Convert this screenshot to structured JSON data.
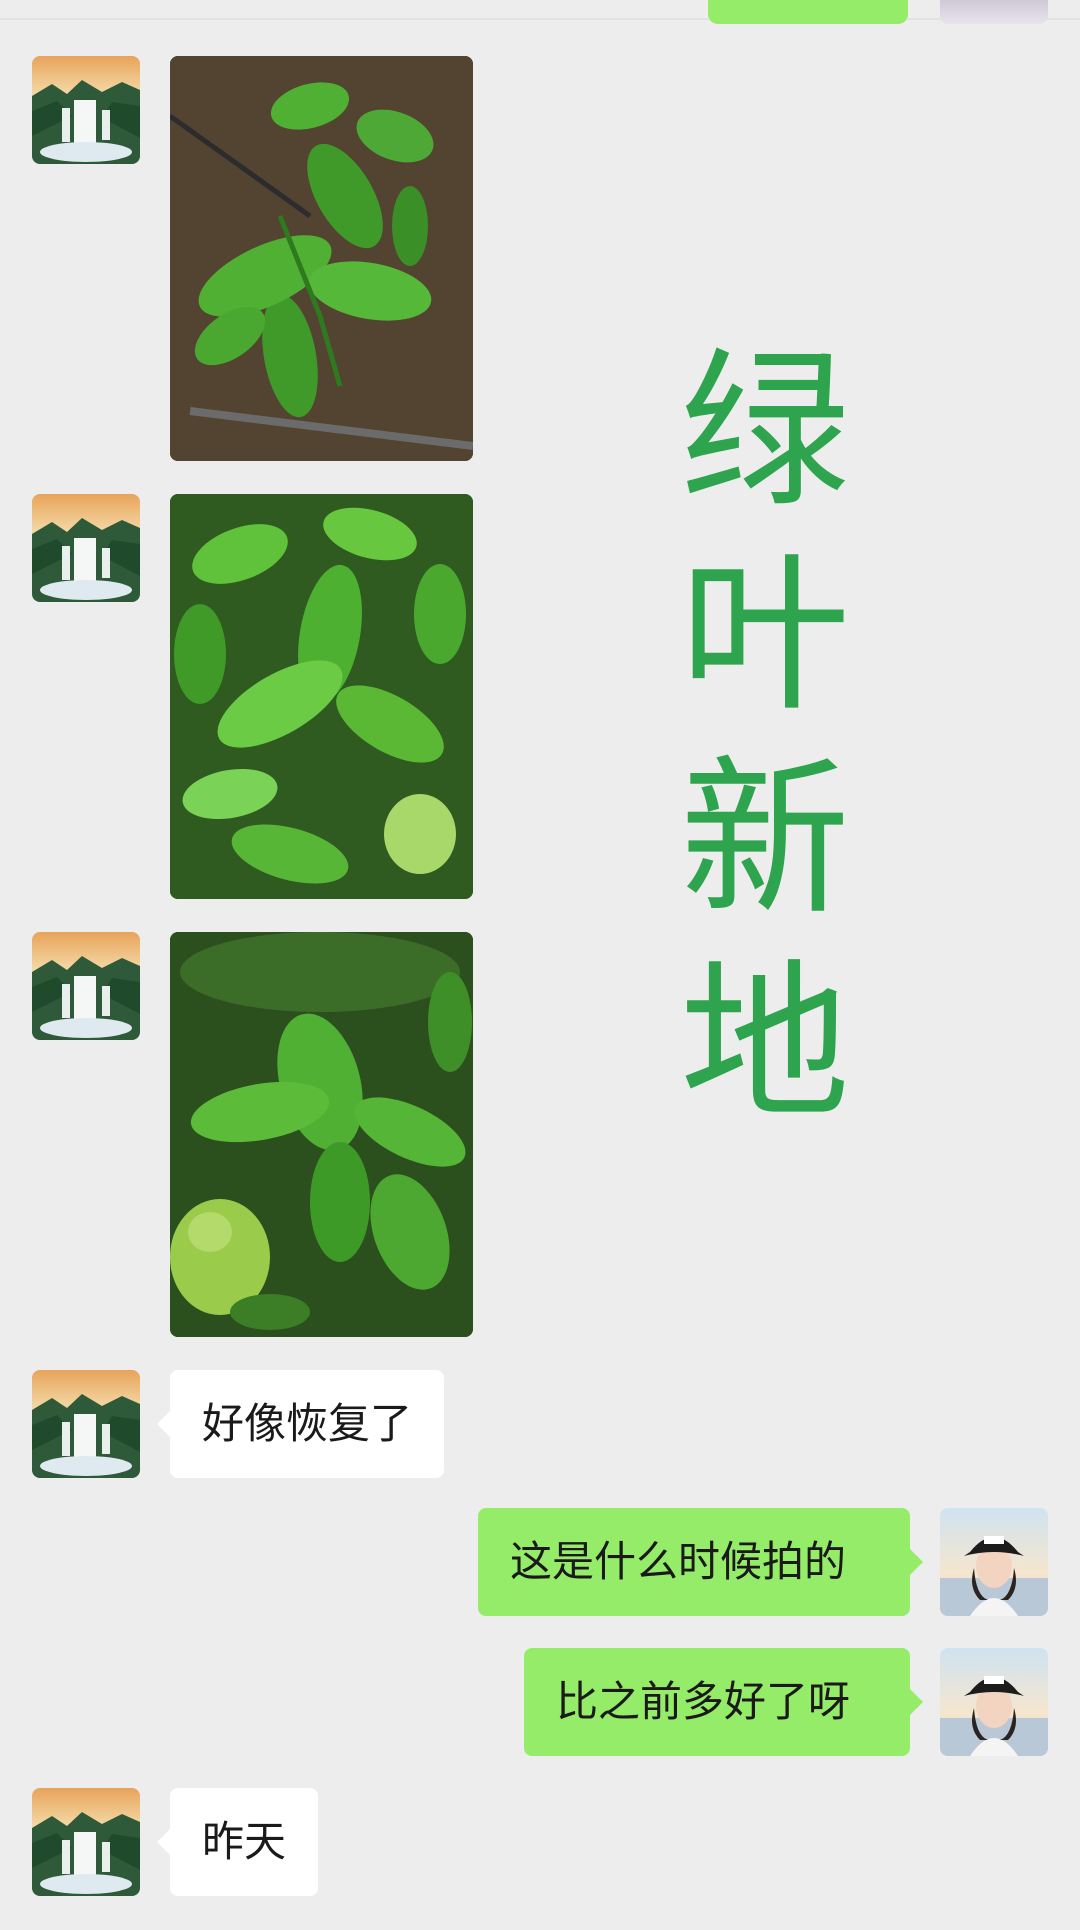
{
  "overlay": {
    "chars": [
      "绿",
      "叶",
      "新",
      "地"
    ],
    "color": "#2ea44f"
  },
  "colors": {
    "background": "#ededed",
    "incoming_bubble": "#ffffff",
    "outgoing_bubble": "#95ec69"
  },
  "messages": [
    {
      "sender": "contact",
      "type": "image",
      "content": "green citrus leaves photo"
    },
    {
      "sender": "contact",
      "type": "image",
      "content": "green citrus leaves photo"
    },
    {
      "sender": "contact",
      "type": "image",
      "content": "green citrus leaves and fruit photo"
    },
    {
      "sender": "contact",
      "type": "text",
      "text": "好像恢复了"
    },
    {
      "sender": "me",
      "type": "text",
      "text": "这是什么时候拍的"
    },
    {
      "sender": "me",
      "type": "text",
      "text": "比之前多好了呀"
    },
    {
      "sender": "contact",
      "type": "text",
      "text": "昨天"
    }
  ],
  "avatars": {
    "contact": "waterfall-landscape-avatar",
    "me": "girl-with-cap-avatar"
  }
}
